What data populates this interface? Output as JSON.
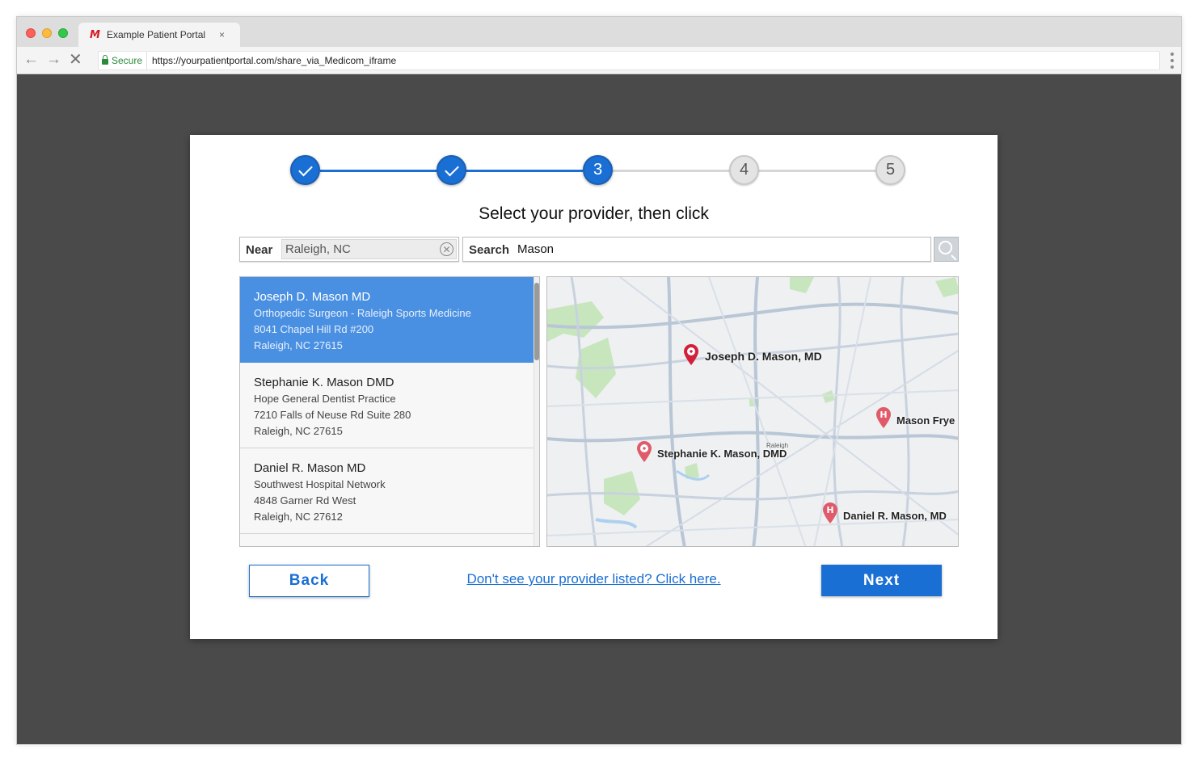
{
  "browser": {
    "tab_title": "Example Patient Portal",
    "tab_logo": "M",
    "tab_close": "×",
    "secure_label": "Secure",
    "url": "https://yourpatientportal.com/share_via_Medicom_iframe",
    "nav_back": "←",
    "nav_forward": "→",
    "nav_stop": "✕"
  },
  "stepper": {
    "steps": [
      {
        "state": "done",
        "label": ""
      },
      {
        "state": "done",
        "label": ""
      },
      {
        "state": "active",
        "label": "3"
      },
      {
        "state": "todo",
        "label": "4"
      },
      {
        "state": "todo",
        "label": "5"
      }
    ],
    "colors": {
      "done": "#1a6fd4",
      "todo": "#d6d6d6"
    }
  },
  "title": "Select your provider, then click",
  "near": {
    "label": "Near",
    "value": "Raleigh, NC",
    "clear": "✕"
  },
  "search": {
    "label": "Search",
    "value": "Mason"
  },
  "providers": [
    {
      "name": "Joseph D. Mason MD",
      "practice": "Orthopedic Surgeon - Raleigh Sports Medicine",
      "address": "8041 Chapel Hill Rd #200",
      "city": "Raleigh, NC 27615",
      "selected": true
    },
    {
      "name": "Stephanie K. Mason DMD",
      "practice": "Hope General Dentist Practice",
      "address": "7210 Falls of Neuse Rd Suite 280",
      "city": "Raleigh, NC 27615",
      "selected": false
    },
    {
      "name": "Daniel R. Mason MD",
      "practice": "Southwest Hospital Network",
      "address": "4848 Garner Rd West",
      "city": "Raleigh, NC 27612",
      "selected": false
    }
  ],
  "map": {
    "pins": [
      {
        "label": "Joseph D. Mason, MD",
        "kind": "clinic",
        "color": "#d21f3c"
      },
      {
        "label": "Mason Frye",
        "kind": "hospital",
        "color": "#e05a6a"
      },
      {
        "label": "Stephanie K. Mason, DMD",
        "kind": "clinic",
        "color": "#e05a6a"
      },
      {
        "label": "Daniel R. Mason, MD",
        "kind": "hospital",
        "color": "#e05a6a"
      }
    ],
    "place_label": "Raleigh"
  },
  "actions": {
    "back": "Back",
    "help_link": "Don't see your provider listed? Click here.",
    "next": "Next"
  }
}
